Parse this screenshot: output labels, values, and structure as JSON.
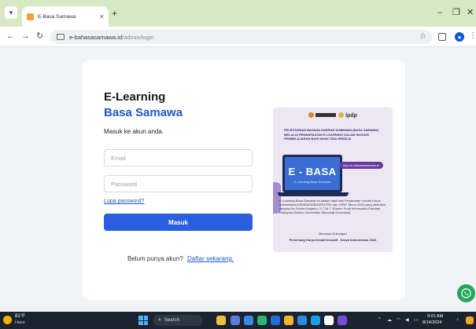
{
  "browser": {
    "tab_title": "E-Basa Samawa",
    "tab_close": "×",
    "new_tab": "+",
    "url_host": "e-bahasasamawa.id",
    "url_path": "/admin/login",
    "profile_initial": "●"
  },
  "login": {
    "brand_line1": "E-Learning",
    "brand_line2": "Basa Samawa",
    "subtitle": "Masuk ke akun anda.",
    "email_placeholder": "Email",
    "password_placeholder": "Password",
    "forgot_password": "Lupa password?",
    "submit": "Masuk",
    "register_prompt": "Belum punya akun?",
    "register_link": "Daftar sekarang."
  },
  "poster": {
    "logos": "lpdp",
    "description": "PELESTARIAN BAHASA DAERAH SUMBAWA (BASA SAMAWA) MELALUI PEMANFAATAN E-LEARNING DALAM INOVASI PEMBELAJARAN BAGI ANAK USIA REMAJA",
    "url": "http://e-bahasasamawa.id",
    "title": "E - BASA",
    "subtitle": "E-Learning Basa Samawa",
    "info": "E-Learning Basa Samawa ini adalah hasil dari Pendanaan Inovasi Karya Indonesiana KEMENDIKBUDRISTEK dan LPDP Tahun 2023 yang diberikan kepada Ibu Shinta Dwijantu, S.T.,M.T. (Dosen Prodi Informatika Fakultas Rekayasa Sistem Universitas Teknologi Sumbawa)",
    "footer1": "Bersama Dukungan",
    "footer2": "Pemenang Karya Kreatif Inovatif - Karya Indonesiana 2023"
  },
  "taskbar": {
    "temperature": "81°F",
    "condition": "Haze",
    "search": "Search",
    "time": "9:01 AM",
    "date": "8/14/2024"
  },
  "colors": {
    "accent": "#2a5fe0",
    "brand_blue": "#1f58c7",
    "tabbar": "#d7e9c4",
    "whatsapp": "#25a75a"
  },
  "icons": [
    "search-icon",
    "star-icon",
    "whatsapp-icon",
    "windows-start-icon",
    "profile-icon"
  ]
}
